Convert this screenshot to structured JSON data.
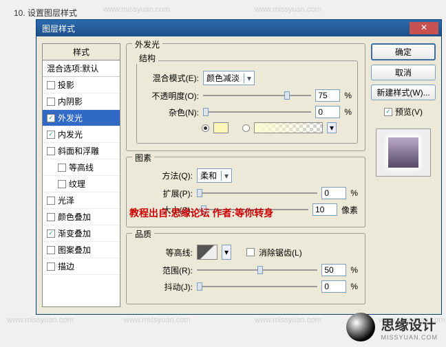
{
  "caption": "10. 设置图层样式",
  "watermark_text": "www.missyuan.com",
  "dialog": {
    "title": "图层样式",
    "close": "✕",
    "left": {
      "header": "样式",
      "blend_defaults": "混合选项:默认",
      "items": [
        {
          "label": "投影",
          "checked": false,
          "selected": false,
          "indent": false
        },
        {
          "label": "内阴影",
          "checked": false,
          "selected": false,
          "indent": false
        },
        {
          "label": "外发光",
          "checked": true,
          "selected": true,
          "indent": false
        },
        {
          "label": "内发光",
          "checked": true,
          "selected": false,
          "indent": false
        },
        {
          "label": "斜面和浮雕",
          "checked": false,
          "selected": false,
          "indent": false
        },
        {
          "label": "等高线",
          "checked": false,
          "selected": false,
          "indent": true
        },
        {
          "label": "纹理",
          "checked": false,
          "selected": false,
          "indent": true
        },
        {
          "label": "光泽",
          "checked": false,
          "selected": false,
          "indent": false
        },
        {
          "label": "颜色叠加",
          "checked": false,
          "selected": false,
          "indent": false
        },
        {
          "label": "渐变叠加",
          "checked": true,
          "selected": false,
          "indent": false
        },
        {
          "label": "图案叠加",
          "checked": false,
          "selected": false,
          "indent": false
        },
        {
          "label": "描边",
          "checked": false,
          "selected": false,
          "indent": false
        }
      ]
    },
    "mid": {
      "outer_glow": "外发光",
      "structure": "结构",
      "blend_mode_label": "混合模式(E):",
      "blend_mode_value": "颜色减淡",
      "opacity_label": "不透明度(O):",
      "opacity_value": "75",
      "pct": "%",
      "noise_label": "杂色(N):",
      "noise_value": "0",
      "swatch_color": "#faf7b8",
      "elements": "图素",
      "technique_label": "方法(Q):",
      "technique_value": "柔和",
      "spread_label": "扩展(P):",
      "spread_value": "0",
      "size_label": "大小(S):",
      "size_value": "10",
      "px": "像素",
      "quality": "品质",
      "contour_label": "等高线:",
      "antialias_label": "消除锯齿(L)",
      "range_label": "范围(R):",
      "range_value": "50",
      "jitter_label": "抖动(J):",
      "jitter_value": "0"
    },
    "right": {
      "ok": "确定",
      "cancel": "取消",
      "new_style": "新建样式(W)...",
      "preview": "预览(V)"
    }
  },
  "credit": "教程出自:思缘论坛      作者:等你转身",
  "logo_text": "思缘设计",
  "logo_sub": "MISSYUAN.COM"
}
